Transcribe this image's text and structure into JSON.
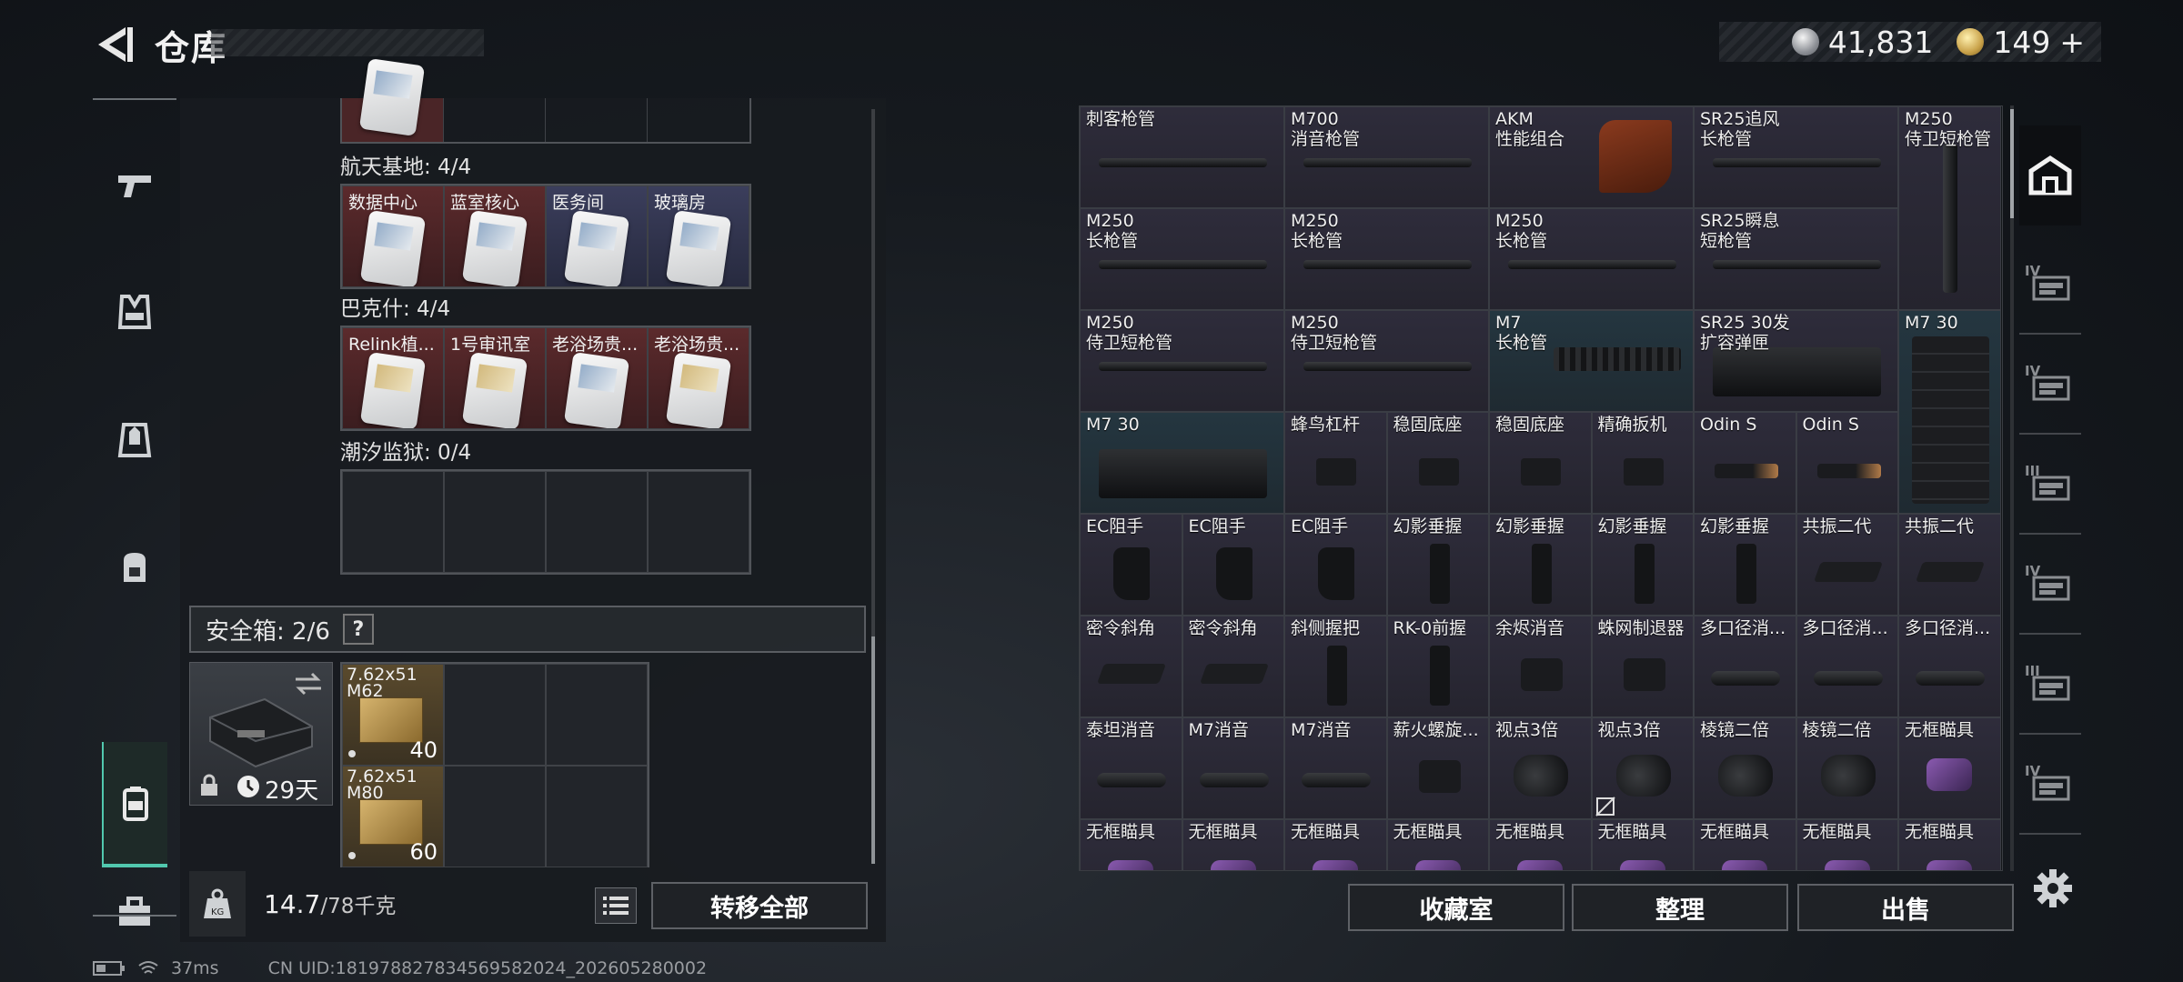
{
  "header": {
    "title": "仓库",
    "back_icon": "back-arrow-icon"
  },
  "currency": {
    "silver": "41,831",
    "gold": "149",
    "plus": "+"
  },
  "sidebar": {
    "items": [
      {
        "icon": "pistol-icon"
      },
      {
        "icon": "vest-icon"
      },
      {
        "icon": "armor-icon"
      },
      {
        "icon": "backpack-icon"
      },
      {
        "icon": "safe-case-icon",
        "active": true
      },
      {
        "icon": "toolbox-icon"
      }
    ]
  },
  "keycards": {
    "groups": [
      {
        "label": "航天基地: 4/4",
        "cells": [
          {
            "label": "数据中心",
            "color": "red"
          },
          {
            "label": "蓝室核心",
            "color": "red"
          },
          {
            "label": "医务间",
            "color": "blue"
          },
          {
            "label": "玻璃房",
            "color": "blue"
          }
        ]
      },
      {
        "label": "巴克什: 4/4",
        "cells": [
          {
            "label": "Relink植...",
            "color": "red"
          },
          {
            "label": "1号审讯室",
            "color": "red"
          },
          {
            "label": "老浴场贵...",
            "color": "red"
          },
          {
            "label": "老浴场贵...",
            "color": "red"
          }
        ]
      },
      {
        "label": "潮汐监狱: 0/4",
        "cells": []
      }
    ]
  },
  "safe": {
    "label": "安全箱: 2/6",
    "help": "?",
    "days": "29天",
    "items": [
      {
        "line1": "7.62x51",
        "line2": "M62",
        "count": "40"
      },
      {
        "line1": "7.62x51",
        "line2": "M80",
        "count": "60"
      }
    ]
  },
  "weight": {
    "current": "14.7",
    "max": "/78千克"
  },
  "buttons": {
    "transfer_all": "转移全部",
    "collection": "收藏室",
    "organize": "整理",
    "sell": "出售"
  },
  "inventory": [
    [
      {
        "l": "刺客枪管"
      },
      {
        "l": "M700\n消音枪管"
      },
      {
        "l": "AKM\n性能组合"
      },
      {
        "l": "SR25追风\n长枪管"
      },
      {
        "l": "M250\n侍卫短枪管"
      }
    ],
    [
      {
        "l": "M250\n长枪管"
      },
      {
        "l": "M250\n长枪管"
      },
      {
        "l": "M250\n长枪管"
      },
      {
        "l": "SR25瞬息\n短枪管"
      }
    ],
    [
      {
        "l": "M250\n侍卫短枪管"
      },
      {
        "l": "M250\n侍卫短枪管"
      },
      {
        "l": "M7\n长枪管"
      },
      {
        "l": "SR25 30发\n扩容弹匣"
      },
      {
        "l": "M7 30"
      }
    ],
    [
      {
        "l": "M7 30"
      },
      {
        "l": "蜂鸟杠杆"
      },
      {
        "l": "稳固底座"
      },
      {
        "l": "稳固底座"
      },
      {
        "l": "精确扳机"
      },
      {
        "l": "Odin S"
      },
      {
        "l": "Odin S"
      }
    ],
    [
      {
        "l": "EC阻手"
      },
      {
        "l": "EC阻手"
      },
      {
        "l": "EC阻手"
      },
      {
        "l": "幻影垂握"
      },
      {
        "l": "幻影垂握"
      },
      {
        "l": "幻影垂握"
      },
      {
        "l": "幻影垂握"
      },
      {
        "l": "共振二代"
      },
      {
        "l": "共振二代"
      }
    ],
    [
      {
        "l": "密令斜角"
      },
      {
        "l": "密令斜角"
      },
      {
        "l": "斜侧握把"
      },
      {
        "l": "RK-0前握"
      },
      {
        "l": "余烬消音"
      },
      {
        "l": "蛛网制退器"
      },
      {
        "l": "多口径消..."
      },
      {
        "l": "多口径消..."
      },
      {
        "l": "多口径消..."
      }
    ],
    [
      {
        "l": "泰坦消音"
      },
      {
        "l": "M7消音"
      },
      {
        "l": "M7消音"
      },
      {
        "l": "薪火螺旋..."
      },
      {
        "l": "视点3倍"
      },
      {
        "l": "视点3倍"
      },
      {
        "l": "棱镜二倍"
      },
      {
        "l": "棱镜二倍"
      },
      {
        "l": "无框瞄具"
      }
    ],
    [
      {
        "l": "无框瞄具"
      },
      {
        "l": "无框瞄具"
      },
      {
        "l": "无框瞄具"
      },
      {
        "l": "无框瞄具"
      },
      {
        "l": "无框瞄具"
      },
      {
        "l": "无框瞄具"
      },
      {
        "l": "无框瞄具"
      },
      {
        "l": "无框瞄具"
      },
      {
        "l": "无框瞄具"
      }
    ]
  ],
  "right_tabs": [
    {
      "icon": "warehouse-icon",
      "active": true
    },
    {
      "icon": "storage-iv-icon",
      "roman": "IV"
    },
    {
      "icon": "medical-iv-icon",
      "roman": "IV"
    },
    {
      "icon": "weapon-iii-icon",
      "roman": "III"
    },
    {
      "icon": "storage-iv-b-icon",
      "roman": "IV"
    },
    {
      "icon": "rack-iii-icon",
      "roman": "III"
    },
    {
      "icon": "rifle-iv-icon",
      "roman": "IV"
    }
  ],
  "status": {
    "ping": "37ms",
    "uid": "CN UID:181978827834569582024_202605280002"
  },
  "colors": {
    "accent": "#51c8ae",
    "item_purple": "#2e2c3b",
    "item_teal": "#243640",
    "card_red": "#5b2a2c",
    "card_blue": "#3b3e5c"
  }
}
